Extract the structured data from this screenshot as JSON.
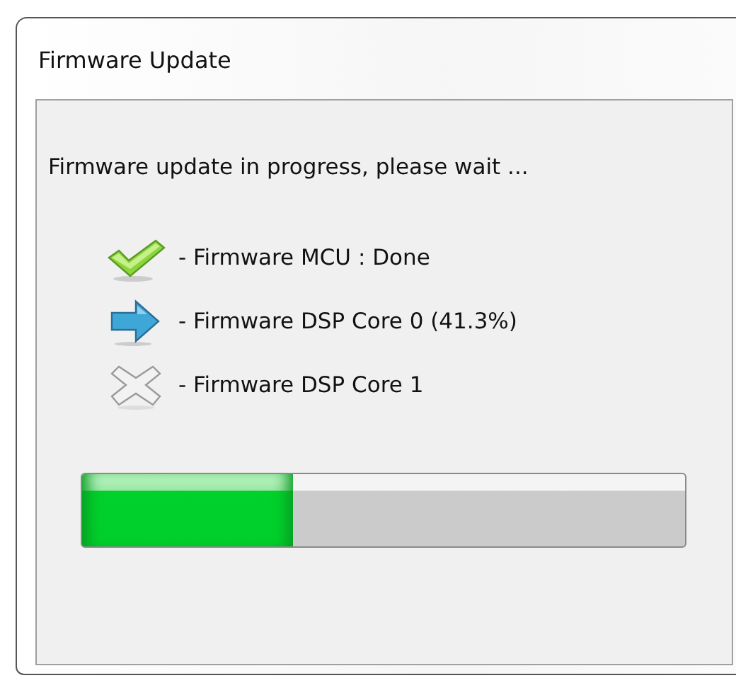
{
  "window": {
    "title": "Firmware Update"
  },
  "message": "Firmware update in progress, please wait ...",
  "steps": [
    {
      "kind": "done",
      "label": "- Firmware MCU : Done"
    },
    {
      "kind": "active",
      "label": "- Firmware DSP Core 0 (41.3%)"
    },
    {
      "kind": "pending",
      "label": "- Firmware DSP Core 1"
    }
  ],
  "progress": {
    "level": 0.35
  }
}
